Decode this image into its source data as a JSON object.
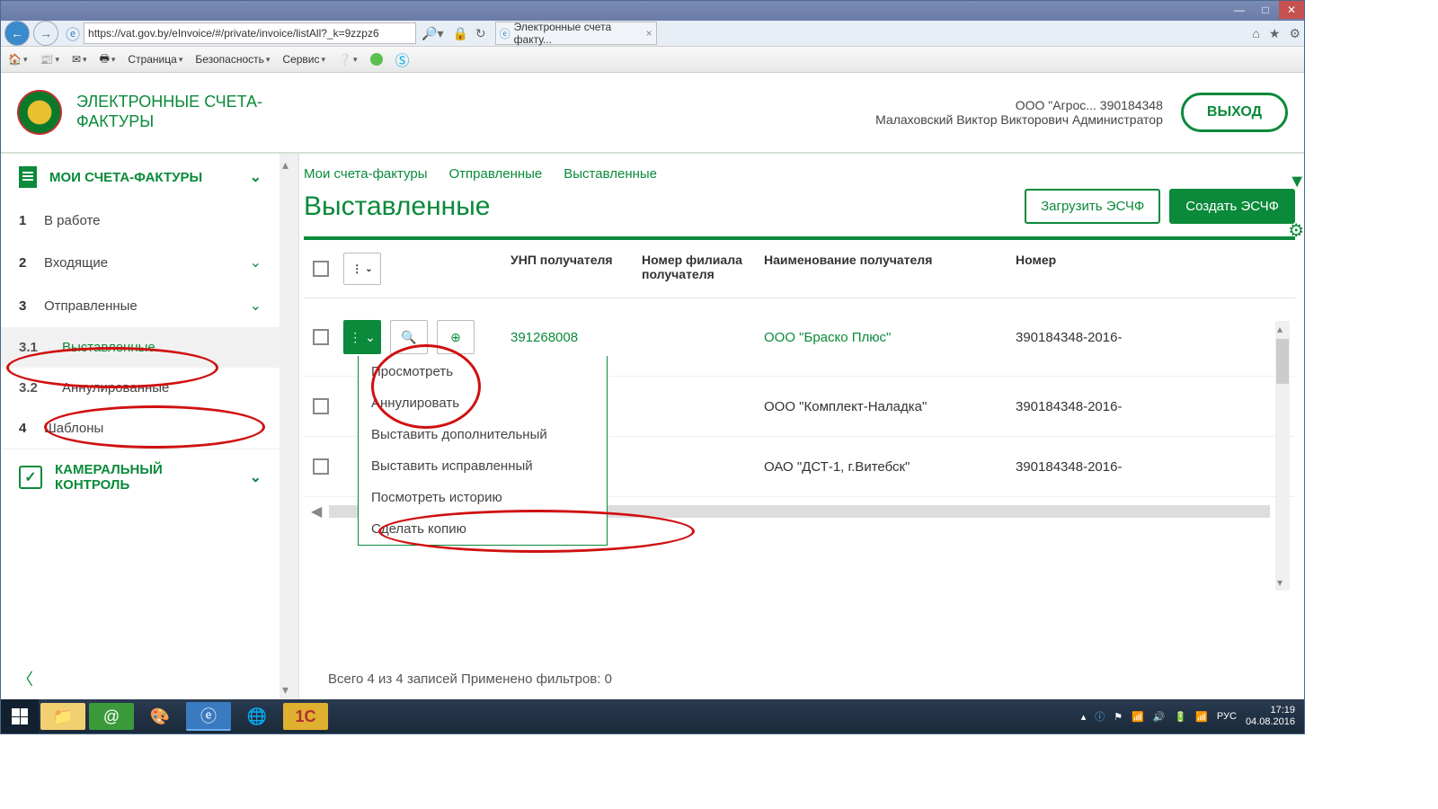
{
  "browser": {
    "url": "https://vat.gov.by/eInvoice/#/private/invoice/listAll?_k=9zzpz6",
    "tab_title": "Электронные счета факту...",
    "toolbar": {
      "page": "Страница",
      "security": "Безопасность",
      "service": "Сервис"
    }
  },
  "header": {
    "app_title_1": "ЭЛЕКТРОННЫЕ СЧЕТА-",
    "app_title_2": "ФАКТУРЫ",
    "company": "ООО \"Агрос... 390184348",
    "user": "Малаховский Виктор Викторович Администратор",
    "logout": "ВЫХОД"
  },
  "sidebar": {
    "group_invoices": "МОИ СЧЕТА-ФАКТУРЫ",
    "items": [
      {
        "num": "1",
        "label": "В работе"
      },
      {
        "num": "2",
        "label": "Входящие"
      },
      {
        "num": "3",
        "label": "Отправленные"
      },
      {
        "num": "3.1",
        "label": "Выставленные"
      },
      {
        "num": "3.2",
        "label": "Аннулированные"
      },
      {
        "num": "4",
        "label": "Шаблоны"
      }
    ],
    "group_control_1": "КАМЕРАЛЬНЫЙ",
    "group_control_2": "КОНТРОЛЬ"
  },
  "breadcrumb": {
    "a": "Мои счета-фактуры",
    "b": "Отправленные",
    "c": "Выставленные"
  },
  "page_title": "Выставленные",
  "buttons": {
    "load": "Загрузить ЭСЧФ",
    "create": "Создать ЭСЧФ"
  },
  "columns": {
    "unp": "УНП получателя",
    "branch": "Номер филиала получателя",
    "name": "Наименование получателя",
    "num": "Номер"
  },
  "rows": [
    {
      "unp": "391268008",
      "name": "ООО \"Браско Плюс\"",
      "num": "390184348-2016-"
    },
    {
      "unp": "",
      "name": "ООО \"Комплект-Наладка\"",
      "num": "390184348-2016-"
    },
    {
      "unp": "",
      "name": "ОАО \"ДСТ-1, г.Витебск\"",
      "num": "390184348-2016-"
    }
  ],
  "dropdown": {
    "view": "Просмотреть",
    "cancel": "Аннулировать",
    "issue_additional": "Выставить дополнительный",
    "issue_corrected": "Выставить исправленный",
    "history": "Посмотреть историю",
    "copy": "Сделать копию"
  },
  "footer": {
    "text": "Всего 4 из 4 записей Применено фильтров: 0"
  },
  "tray": {
    "lang": "РУС",
    "time": "17:19",
    "date": "04.08.2016"
  }
}
